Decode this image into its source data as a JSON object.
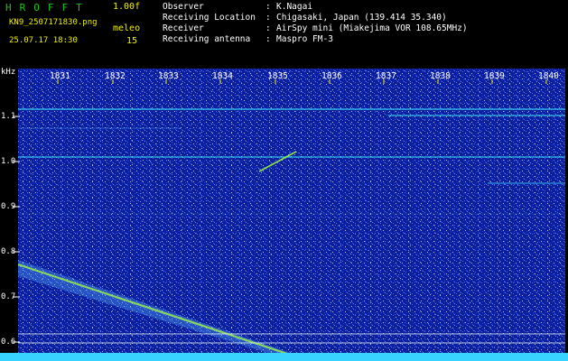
{
  "header": {
    "brand": "HROFFT",
    "version": "1.00f",
    "filename": "KN9_2507171830.png",
    "meleo_label": "meleo",
    "datetime": "25.07.17 18:30",
    "meleo_value": "15",
    "meta": [
      {
        "label": "Observer",
        "value": "K.Nagai"
      },
      {
        "label": "Receiving Location",
        "value": "Chigasaki, Japan (139.414 35.340)"
      },
      {
        "label": "Receiver",
        "value": "AirSpy mini (Miakejima VOR 108.65MHz)"
      },
      {
        "label": "Receiving antenna",
        "value": "Maspro FM-3"
      }
    ]
  },
  "chart_data": {
    "type": "heatmap",
    "y_unit": "kHz",
    "y_ticks": [
      "1.1",
      "1.0",
      "0.9",
      "0.8",
      "0.7",
      "0.6"
    ],
    "x_ticks": [
      "1831",
      "1832",
      "1833",
      "1834",
      "1835",
      "1836",
      "1837",
      "1838",
      "1839",
      "1840"
    ],
    "colors": {
      "background": "#0b1f9e",
      "trace": "#3ce6ff",
      "echo": "#a6ff3c",
      "strip": "#39d3ff"
    }
  }
}
